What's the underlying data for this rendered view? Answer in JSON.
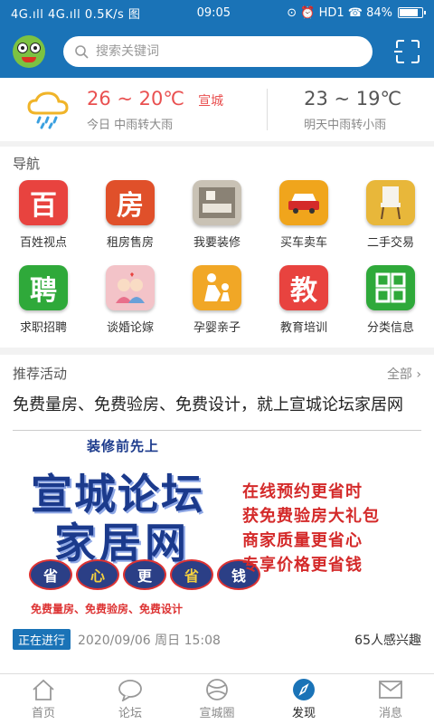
{
  "status_bar": {
    "left": "4G.ıll 4G.ıll 0.5K/s 图",
    "time": "09:05",
    "right": "⊙ ⏰ HD1 ☎ 84%",
    "battery_level": 0.84
  },
  "header": {
    "search_placeholder": "搜索关键词",
    "avatar_icon": "frog-avatar-icon",
    "scan_icon": "scan-icon"
  },
  "weather": {
    "today": {
      "temp": "26 ~ 20℃",
      "city": "宣城",
      "desc": "今日 中雨转大雨"
    },
    "tomorrow": {
      "temp": "23 ~ 19℃",
      "desc": "明天中雨转小雨"
    }
  },
  "nav": {
    "title": "导航",
    "items": [
      {
        "label": "百姓视点",
        "glyph": "百",
        "color": "#e8433f",
        "icon": "baixing-icon"
      },
      {
        "label": "租房售房",
        "glyph": "房",
        "color": "#e0502a",
        "icon": "house-icon"
      },
      {
        "label": "我要装修",
        "glyph": "",
        "color": "#c9c2b5",
        "icon": "renovation-photo-icon"
      },
      {
        "label": "买车卖车",
        "glyph": "",
        "color": "#f0a51c",
        "icon": "car-icon"
      },
      {
        "label": "二手交易",
        "glyph": "",
        "color": "#e8b73a",
        "icon": "chair-icon"
      },
      {
        "label": "求职招聘",
        "glyph": "聘",
        "color": "#2fa93a",
        "icon": "recruit-icon"
      },
      {
        "label": "谈婚论嫁",
        "glyph": "",
        "color": "#f3c3c8",
        "icon": "couple-icon"
      },
      {
        "label": "孕婴亲子",
        "glyph": "",
        "color": "#f1a726",
        "icon": "family-icon"
      },
      {
        "label": "教育培训",
        "glyph": "教",
        "color": "#e8433f",
        "icon": "education-icon"
      },
      {
        "label": "分类信息",
        "glyph": "",
        "color": "#2fa93a",
        "icon": "grid-icon"
      }
    ]
  },
  "promo": {
    "title": "推荐活动",
    "more": "全部",
    "headline": "免费量房、免费验房、免费设计，就上宣城论坛家居网",
    "banner": {
      "kicker": "装修前先上",
      "brand_line1": "宣城论坛",
      "brand_line2": "家居网",
      "circles": [
        "省",
        "心",
        "更",
        "省",
        "钱"
      ],
      "foot": "免费量房、免费验房、免费设计",
      "perks": [
        "在线预约更省时",
        "获免费验房大礼包",
        "商家质量更省心",
        "专享价格更省钱"
      ]
    },
    "status_badge": "正在进行",
    "date": "2020/09/06 周日 15:08",
    "interest": "65人感兴趣"
  },
  "tabs": [
    {
      "label": "首页",
      "icon": "home-icon"
    },
    {
      "label": "论坛",
      "icon": "chat-bubble-icon"
    },
    {
      "label": "宣城圈",
      "icon": "circle-icon"
    },
    {
      "label": "发现",
      "icon": "compass-icon",
      "active": true
    },
    {
      "label": "消息",
      "icon": "mail-icon"
    }
  ],
  "colors": {
    "brand": "#1a73b7",
    "accent": "#e95050"
  }
}
